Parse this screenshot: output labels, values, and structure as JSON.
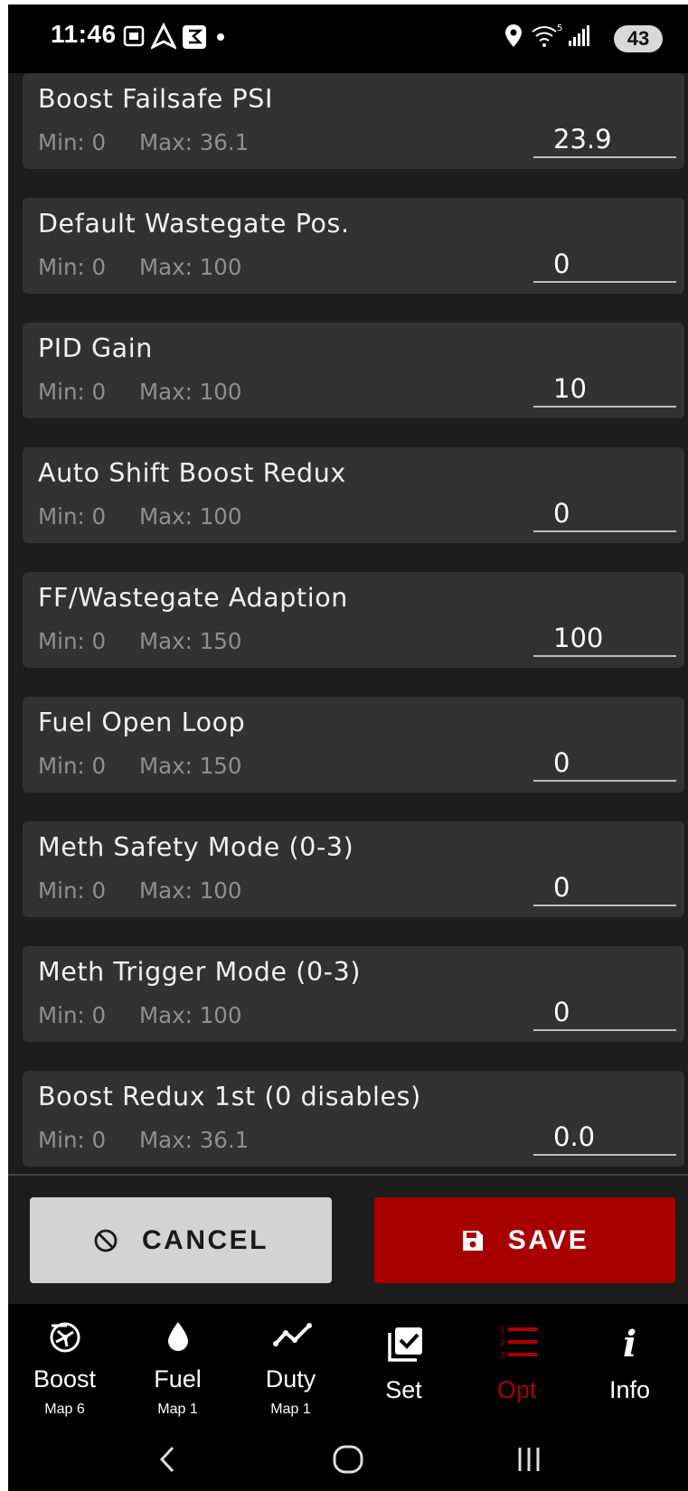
{
  "status_bar": {
    "time": "11:46",
    "battery": "43",
    "icons": [
      "screenshot-icon",
      "navigation-arrow-icon",
      "app-icon",
      "dot-icon",
      "location-icon",
      "wifi-icon",
      "signal-icon"
    ]
  },
  "settings": [
    {
      "title": "Boost Failsafe PSI",
      "min": "Min: 0",
      "max": "Max: 36.1",
      "value": "23.9"
    },
    {
      "title": "Default Wastegate Pos.",
      "min": "Min: 0",
      "max": "Max: 100",
      "value": "0"
    },
    {
      "title": "PID Gain",
      "min": "Min: 0",
      "max": "Max: 100",
      "value": "10"
    },
    {
      "title": "Auto Shift Boost Redux",
      "min": "Min: 0",
      "max": "Max: 100",
      "value": "0"
    },
    {
      "title": "FF/Wastegate Adaption",
      "min": "Min: 0",
      "max": "Max: 150",
      "value": "100"
    },
    {
      "title": "Fuel Open Loop",
      "min": "Min: 0",
      "max": "Max: 150",
      "value": "0"
    },
    {
      "title": "Meth Safety Mode (0-3)",
      "min": "Min: 0",
      "max": "Max: 100",
      "value": "0"
    },
    {
      "title": "Meth Trigger Mode (0-3)",
      "min": "Min: 0",
      "max": "Max: 100",
      "value": "0"
    },
    {
      "title": "Boost Redux 1st (0 disables)",
      "min": "Min: 0",
      "max": "Max: 36.1",
      "value": "0.0"
    }
  ],
  "actions": {
    "cancel_label": "CANCEL",
    "save_label": "SAVE"
  },
  "nav": [
    {
      "label": "Boost",
      "sub": "Map 6",
      "icon": "turbo-icon"
    },
    {
      "label": "Fuel",
      "sub": "Map 1",
      "icon": "fuel-drop-icon"
    },
    {
      "label": "Duty",
      "sub": "Map 1",
      "icon": "trend-line-icon"
    },
    {
      "label": "Set",
      "sub": "",
      "icon": "checkbox-stack-icon"
    },
    {
      "label": "Opt",
      "sub": "",
      "icon": "numbered-list-icon",
      "active": true
    },
    {
      "label": "Info",
      "sub": "",
      "icon": "info-icon"
    }
  ],
  "colors": {
    "accent": "#a80000",
    "card": "#323232",
    "background": "#1d1d1d"
  }
}
